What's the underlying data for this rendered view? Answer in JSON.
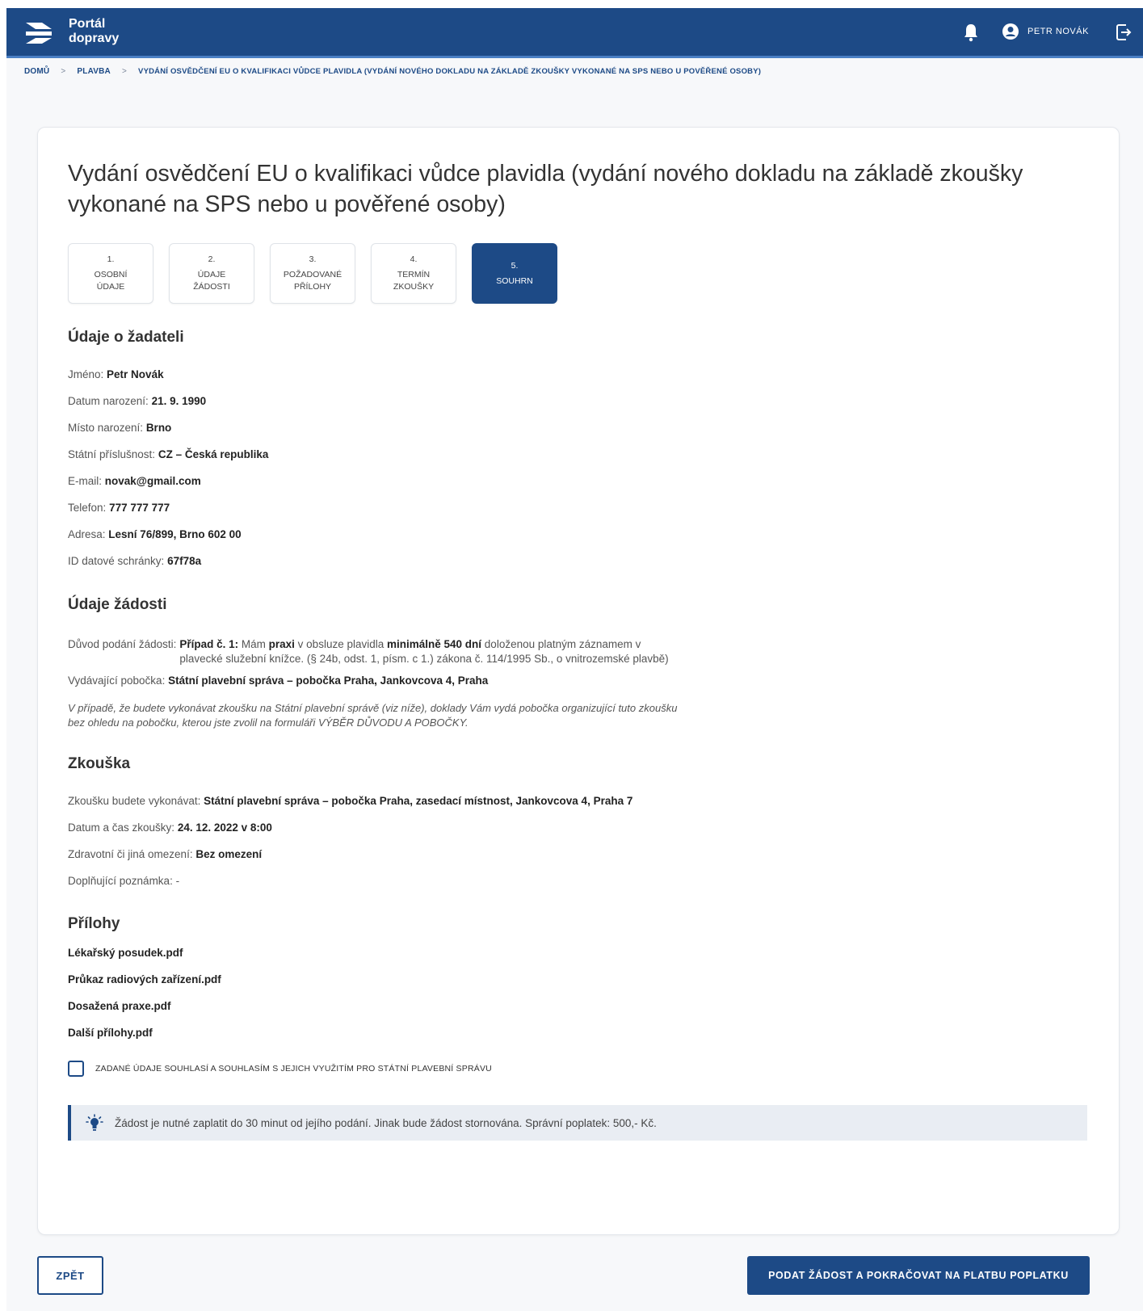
{
  "header": {
    "brand_line1": "Portál",
    "brand_line2": "dopravy",
    "user_name": "PETR NOVÁK",
    "icons": [
      "logo-icon",
      "bell-icon",
      "user-icon",
      "logout-icon"
    ]
  },
  "breadcrumb": {
    "items": [
      "DOMŮ",
      "PLAVBA",
      "VYDÁNÍ OSVĚDČENÍ EU O KVALIFIKACI VŮDCE PLAVIDLA (VYDÁNÍ NOVÉHO DOKLADU NA ZÁKLADĚ ZKOUŠKY VYKONANÉ NA SPS NEBO U POVĚŘENÉ OSOBY)"
    ],
    "separator": ">"
  },
  "page": {
    "title": "Vydání osvědčení EU o kvalifikaci vůdce plavidla (vydání nového dokladu na základě zkoušky vykonané na SPS nebo u pověřené osoby)"
  },
  "steps": [
    {
      "num": "1.",
      "line1": "OSOBNÍ",
      "line2": "ÚDAJE",
      "active": false
    },
    {
      "num": "2.",
      "line1": "ÚDAJE",
      "line2": "ŽÁDOSTI",
      "active": false
    },
    {
      "num": "3.",
      "line1": "POŽADOVANÉ",
      "line2": "PŘÍLOHY",
      "active": false
    },
    {
      "num": "4.",
      "line1": "TERMÍN",
      "line2": "ZKOUŠKY",
      "active": false
    },
    {
      "num": "5.",
      "line1": "SOUHRN",
      "line2": "",
      "active": true
    }
  ],
  "applicant": {
    "heading": "Údaje o žadateli",
    "fields": [
      {
        "label": "Jméno:",
        "value": "Petr Novák"
      },
      {
        "label": "Datum narození:",
        "value": "21. 9. 1990"
      },
      {
        "label": "Místo narození:",
        "value": "Brno"
      },
      {
        "label": "Státní příslušnost:",
        "value": "CZ – Česká republika"
      },
      {
        "label": "E-mail:",
        "value": "novak@gmail.com"
      },
      {
        "label": "Telefon:",
        "value": "777 777 777"
      },
      {
        "label": "Adresa:",
        "value": "Lesní 76/899, Brno 602 00"
      },
      {
        "label": "ID datové schránky:",
        "value": "67f78a"
      }
    ]
  },
  "request": {
    "heading": "Údaje žádosti",
    "reason_label": "Důvod podání žádosti:",
    "reason_case": "Případ č. 1:",
    "reason_t1": " Mám ",
    "reason_b1": "praxi",
    "reason_t2": " v obsluze plavidla ",
    "reason_b2": "minimálně 540 dní",
    "reason_t3": " doloženou platným záznamem v",
    "reason_line2": "plavecké služební knížce. (§ 24b, odst. 1, písm. c 1.) zákona č. 114/1995 Sb., o vnitrozemské plavbě)",
    "branch_label": "Vydávající pobočka:",
    "branch_value": "Státní plavební správa – pobočka Praha, Jankovcova 4, Praha",
    "note_line1": "V případě, že budete vykonávat zkoušku na Státní plavební správě (viz níže), doklady Vám vydá pobočka organizující tuto zkoušku",
    "note_line2": "bez ohledu na pobočku, kterou jste zvolil na formuláři VÝBĚR DŮVODU A POBOČKY."
  },
  "exam": {
    "heading": "Zkouška",
    "fields": [
      {
        "label": "Zkoušku budete vykonávat:",
        "value": "Státní plavební správa – pobočka Praha, zasedací místnost, Jankovcova 4, Praha 7"
      },
      {
        "label": "Datum a čas zkoušky:",
        "value": "24. 12. 2022 v 8:00"
      },
      {
        "label": "Zdravotní či jiná omezení:",
        "value": "Bez omezení"
      },
      {
        "label": "Doplňující poznámka: -",
        "value": ""
      }
    ]
  },
  "attachments": {
    "heading": "Přílohy",
    "files": [
      "Lékařský posudek.pdf",
      "Průkaz radiových zařízení.pdf",
      "Dosažená praxe.pdf",
      "Další přílohy.pdf"
    ]
  },
  "consent": {
    "label": "ZADANÉ ÚDAJE SOUHLASÍ A SOUHLASÍM S JEJICH VYUŽITÍM PRO STÁTNÍ PLAVEBNÍ SPRÁVU",
    "checked": false
  },
  "info": {
    "text": "Žádost je nutné zaplatit do 30 minut od jejího podání. Jinak bude žádost stornována. Správní poplatek: 500,- Kč."
  },
  "actions": {
    "back_label": "ZPĚT",
    "submit_label": "PODAT ŽÁDOST A POKRAČOVAT NA PLATBU POPLATKU"
  },
  "colors": {
    "primary": "#1d4a86",
    "header_border": "#4a7fc4",
    "info_bg": "#e9edf3",
    "info_icon": "#1d4a86"
  }
}
